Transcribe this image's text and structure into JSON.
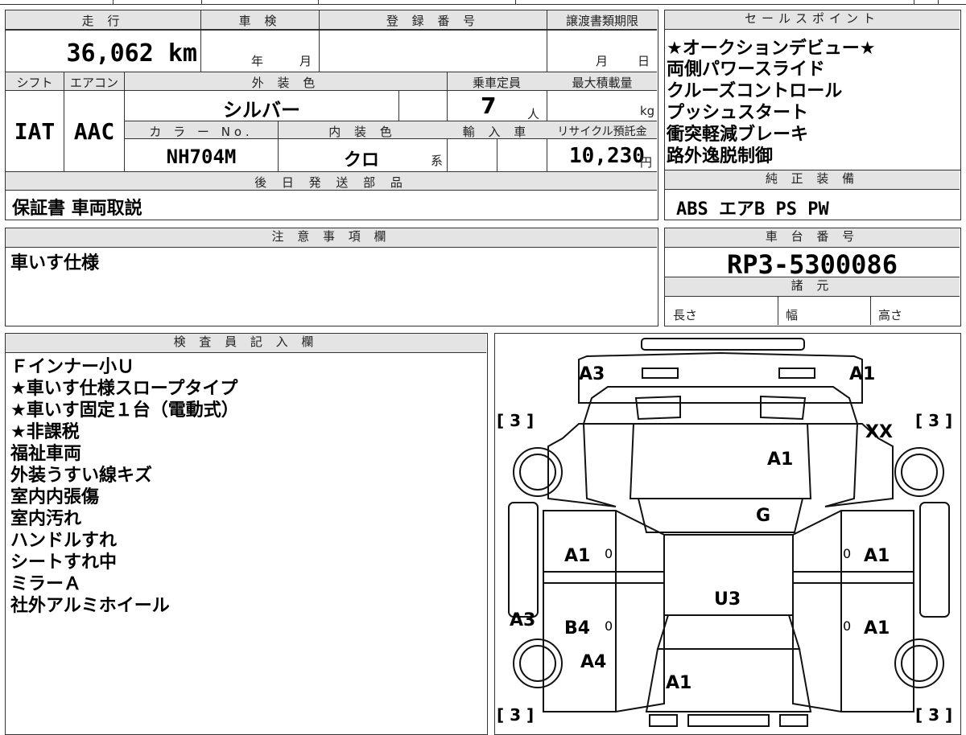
{
  "vehicle": {
    "mileage_label": "走 行",
    "mileage": "36,062 km",
    "inspection_label": "車 検",
    "inspection_year": "年",
    "inspection_month": "月",
    "registration_label": "登 録 番 号",
    "transfer_deadline_label": "譲渡書類期限",
    "transfer_month": "月",
    "transfer_day": "日",
    "shift_label": "シフト",
    "shift": "IAT",
    "ac_label": "エアコン",
    "ac": "AAC",
    "exterior_color_label": "外 装 色",
    "exterior_color": "シルバー",
    "capacity_label": "乗車定員",
    "capacity": "7",
    "capacity_unit": "人",
    "max_load_label": "最大積載量",
    "max_load_unit": "kg",
    "color_no_label": "カ ラ ー No.",
    "color_no": "NH704M",
    "interior_color_label": "内 装 色",
    "interior_color": "クロ",
    "interior_suffix": "系",
    "import_label": "輸 入 車",
    "recycle_label": "リサイクル預託金",
    "recycle_fee": "10,230",
    "recycle_unit": "円",
    "later_parts_label": "後 日 発 送 部 品",
    "later_parts": "保証書 車両取説"
  },
  "sales_points": {
    "label": "セールスポイント",
    "items": [
      "★オークションデビュー★",
      "両側パワースライド",
      "クルーズコントロール",
      "プッシュスタート",
      "衝突軽減ブレーキ",
      "路外逸脱制御"
    ]
  },
  "standard_equipment": {
    "label": "純 正 装 備",
    "value": "ABS エアB PS PW"
  },
  "notes": {
    "label": "注 意 事 項 欄",
    "value": "車いす仕様"
  },
  "chassis": {
    "label": "車 台 番 号",
    "number": "RP3-5300086",
    "specs_label": "諸 元",
    "length_label": "長さ",
    "width_label": "幅",
    "height_label": "高さ"
  },
  "inspector": {
    "label": "検 査 員 記 入 欄",
    "lines": [
      "Ｆインナー小Ｕ",
      "★車いす仕様スロープタイプ",
      "★車いす固定１台（電動式）",
      "★非課税",
      "福祉車両",
      "外装うすい線キズ",
      "室内内張傷",
      "室内汚れ",
      "ハンドルすれ",
      "シートすれ中",
      "ミラーＡ",
      "社外アルミホイール"
    ]
  },
  "diagram": {
    "tire_marks": [
      "[ 3 ]",
      "[ 3 ]",
      "[ 3 ]",
      "[ 3 ]"
    ],
    "front_left": "A3",
    "front_right": "A1",
    "right_front_fender": "XX",
    "hood": "A1",
    "windshield": "G",
    "left_front_door": "A1",
    "right_front_door": "A1",
    "roof": "U3",
    "left_rear_door": "B4",
    "right_rear_door": "A1",
    "left_rear_quarter": "A3",
    "left_rear_bottom": "A4",
    "rear_gate": "A1",
    "door_small_marks": [
      "0",
      "0",
      "0",
      "0"
    ]
  }
}
